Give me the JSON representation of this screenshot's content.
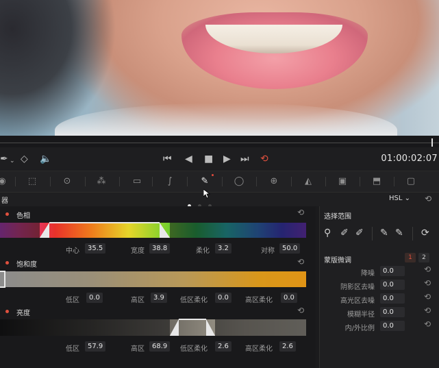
{
  "transport": {
    "buttons": [
      "⏮",
      "◀",
      "■",
      "▶",
      "⏭",
      "⟲"
    ],
    "timecode": "01:00:02:07"
  },
  "panel": {
    "title": "器",
    "mode": "HSL",
    "mode_chevron": "⌄",
    "reset_icon": "⟲"
  },
  "hue": {
    "label": "色相",
    "fields": [
      {
        "label": "中心",
        "value": "35.5"
      },
      {
        "label": "宽度",
        "value": "38.8"
      },
      {
        "label": "柔化",
        "value": "3.2"
      },
      {
        "label": "对称",
        "value": "50.0"
      }
    ]
  },
  "saturation": {
    "label": "饱和度",
    "fields": [
      {
        "label": "低区",
        "value": "0.0"
      },
      {
        "label": "高区",
        "value": "3.9"
      },
      {
        "label": "低区柔化",
        "value": "0.0"
      },
      {
        "label": "高区柔化",
        "value": "0.0"
      }
    ]
  },
  "luminance": {
    "label": "亮度",
    "fields": [
      {
        "label": "低区",
        "value": "57.9"
      },
      {
        "label": "高区",
        "value": "68.9"
      },
      {
        "label": "低区柔化",
        "value": "2.6"
      },
      {
        "label": "高区柔化",
        "value": "2.6"
      }
    ]
  },
  "selection": {
    "title": "选择范围",
    "matte_title": "蒙版微调",
    "tabs": [
      "1",
      "2"
    ],
    "rows": [
      {
        "label": "降噪",
        "value": "0.0"
      },
      {
        "label": "阴影区去噪",
        "value": "0.0"
      },
      {
        "label": "高光区去噪",
        "value": "0.0"
      },
      {
        "label": "模糊半径",
        "value": "0.0"
      },
      {
        "label": "内/外比例",
        "value": "0.0"
      }
    ]
  },
  "colors": {
    "accent": "#e0503e",
    "panel_bg": "#1f1f21"
  }
}
